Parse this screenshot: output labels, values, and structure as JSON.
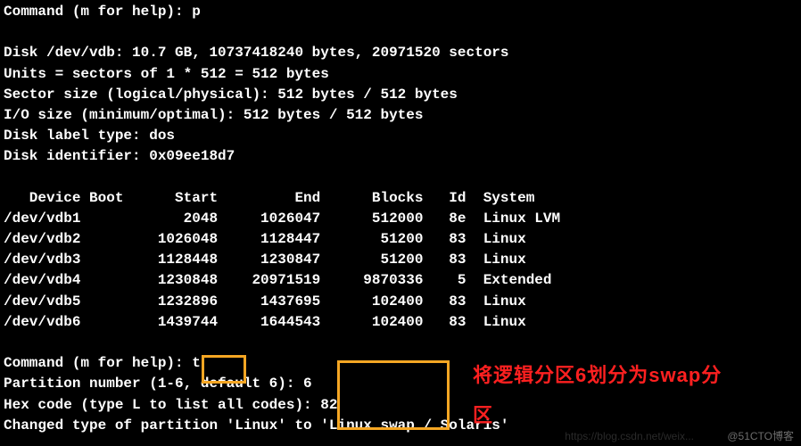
{
  "lines": {
    "l0": "Command (m for help): p",
    "l1": "",
    "l2": "Disk /dev/vdb: 10.7 GB, 10737418240 bytes, 20971520 sectors",
    "l3": "Units = sectors of 1 * 512 = 512 bytes",
    "l4": "Sector size (logical/physical): 512 bytes / 512 bytes",
    "l5": "I/O size (minimum/optimal): 512 bytes / 512 bytes",
    "l6": "Disk label type: dos",
    "l7": "Disk identifier: 0x09ee18d7",
    "l8": "",
    "l9": "   Device Boot      Start         End      Blocks   Id  System",
    "l10": "/dev/vdb1            2048     1026047      512000   8e  Linux LVM",
    "l11": "/dev/vdb2         1026048     1128447       51200   83  Linux",
    "l12": "/dev/vdb3         1128448     1230847       51200   83  Linux",
    "l13": "/dev/vdb4         1230848    20971519     9870336    5  Extended",
    "l14": "/dev/vdb5         1232896     1437695      102400   83  Linux",
    "l15": "/dev/vdb6         1439744     1644543      102400   83  Linux",
    "l16": "",
    "l17": "Command (m for help): t",
    "l18": "Partition number (1-6, default 6): 6",
    "l19": "Hex code (type L to list all codes): 82",
    "l20": "Changed type of partition 'Linux' to 'Linux swap / Solaris'"
  },
  "annot": {
    "line1": "将逻辑分区6划分为swap分",
    "line2": "区"
  },
  "wm": {
    "w1": "https://blog.csdn.net/weix...",
    "w2": "@51CTO博客"
  }
}
